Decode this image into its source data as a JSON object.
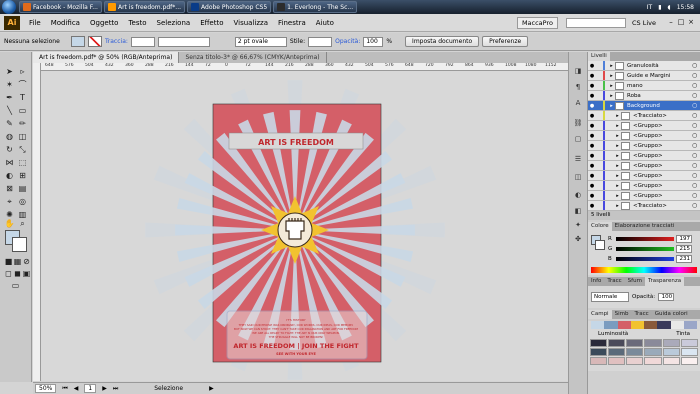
{
  "taskbar": {
    "tasks": [
      {
        "label": "Facebook - Mozilla F...",
        "color": "#e06a1b"
      },
      {
        "label": "Art is freedom.pdf*...",
        "color": "#ff9a00"
      },
      {
        "label": "Adobe Photoshop CS5",
        "color": "#0a3c88"
      },
      {
        "label": "1. Everlong - The Sc...",
        "color": "#2c2c2c"
      }
    ],
    "language": "IT",
    "time": "15:58"
  },
  "menubar": {
    "app_logo": "Ai",
    "items": [
      "File",
      "Modifica",
      "Oggetto",
      "Testo",
      "Seleziona",
      "Effetto",
      "Visualizza",
      "Finestra",
      "Aiuto"
    ],
    "workspace": "MaccaPro",
    "cs_live": "CS Live"
  },
  "controlbar": {
    "selection_label": "Nessuna selezione",
    "stroke_label": "Traccia:",
    "stroke_style": "2 pt ovale",
    "style_label": "Stile:",
    "opacity_label": "Opacità:",
    "opacity_value": "100",
    "opacity_unit": "%",
    "doc_setup_button": "Imposta documento",
    "preferences_button": "Preferenze"
  },
  "tabs": [
    {
      "label": "Art is freedom.pdf* @ 50% (RGB/Anteprima)",
      "active": true
    },
    {
      "label": "Senza titolo-3* @ 66,67% (CMYK/Anteprima)",
      "active": false
    }
  ],
  "ruler_ticks": [
    "648",
    "576",
    "504",
    "432",
    "360",
    "288",
    "216",
    "144",
    "72",
    "0",
    "72",
    "144",
    "216",
    "288",
    "360",
    "432",
    "504",
    "576",
    "648",
    "720",
    "792",
    "864",
    "936",
    "1008",
    "1080",
    "1152"
  ],
  "artwork": {
    "title": "ART IS FREEDOM",
    "small_text_1": "IT'S HISTORY",
    "small_text_2": "THEY SAID OUR PEOPLE WAS ORDINARY, OUR WORDS, OUR IDEAS, OUR MEMORY.",
    "small_text_3": "BUT NOW WE CAN SHOUT. THEY CAN'T TAKE OUR IMAGINATION AND ART FOR FREEDOM",
    "small_text_4": "WE ARE ALL READY TO FIGHT. THE ART IS OUR ONLY WEAPON.",
    "small_text_5": "THE STRUGGLE WILL NOT BE BROKEN!",
    "headline": "ART IS FREEDOM | JOIN THE FIGHT",
    "subline": "SEE WITH YOUR EYE",
    "colors": {
      "background": "#d45f68",
      "rays": "#c9d8e6",
      "star": "#f2c230",
      "banner": "#d8d8d8",
      "text_red": "#c0272d"
    }
  },
  "statusbar": {
    "zoom": "50%",
    "artboard": "1",
    "tool": "Selezione"
  },
  "layers_panel": {
    "tab": "Livelli",
    "layers": [
      {
        "name": "Granulosità",
        "color": "#4f7fd8",
        "selected": false,
        "indent": 0
      },
      {
        "name": "Guide e Margini",
        "color": "#e04848",
        "selected": false,
        "indent": 0
      },
      {
        "name": "mano",
        "color": "#48c048",
        "selected": false,
        "indent": 0
      },
      {
        "name": "Roba",
        "color": "#4848e0",
        "selected": false,
        "indent": 0
      },
      {
        "name": "Background",
        "color": "#d8d840",
        "selected": true,
        "indent": 0
      },
      {
        "name": "<Tracciato>",
        "color": "#d8d840",
        "selected": false,
        "indent": 1
      },
      {
        "name": "<Gruppo>",
        "color": "#4848e0",
        "selected": false,
        "indent": 1
      },
      {
        "name": "<Gruppo>",
        "color": "#4848e0",
        "selected": false,
        "indent": 1
      },
      {
        "name": "<Gruppo>",
        "color": "#4848e0",
        "selected": false,
        "indent": 1
      },
      {
        "name": "<Gruppo>",
        "color": "#4848e0",
        "selected": false,
        "indent": 1
      },
      {
        "name": "<Gruppo>",
        "color": "#4848e0",
        "selected": false,
        "indent": 1
      },
      {
        "name": "<Gruppo>",
        "color": "#4848e0",
        "selected": false,
        "indent": 1
      },
      {
        "name": "<Gruppo>",
        "color": "#4848e0",
        "selected": false,
        "indent": 1
      },
      {
        "name": "<Gruppo>",
        "color": "#4848e0",
        "selected": false,
        "indent": 1
      },
      {
        "name": "<Tracciato>",
        "color": "#4848e0",
        "selected": false,
        "indent": 1
      }
    ],
    "footer": "5 livelli"
  },
  "color_panel": {
    "tab_colore": "Colore",
    "tab_elab": "Elaborazione tracciati",
    "channels": [
      {
        "label": "R",
        "value": "197",
        "color": "#e02020"
      },
      {
        "label": "G",
        "value": "215",
        "color": "#20c020"
      },
      {
        "label": "B",
        "value": "231",
        "color": "#2040e0"
      }
    ]
  },
  "transparency_panel": {
    "tabs": [
      "Info",
      "Tracc",
      "Sfum",
      "Trasparenza"
    ],
    "blend_mode": "Normale",
    "opacity_label": "Opacità:",
    "opacity_value": "100"
  },
  "swatches_panel": {
    "tabs": [
      "Campi",
      "Simb",
      "Tracc",
      "Guida colori"
    ],
    "luminosity_label": "Luminosità",
    "tint_label": "Tinta"
  }
}
